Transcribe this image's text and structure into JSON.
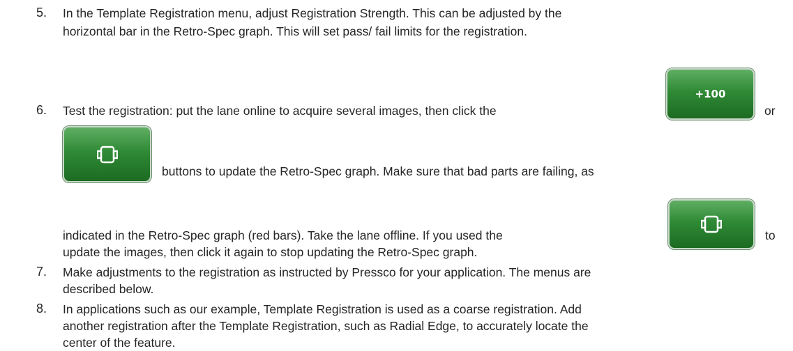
{
  "items": [
    {
      "number": "5.",
      "lines": [
        "In the Template Registration menu, adjust Registration Strength. This can be adjusted by the",
        "horizontal bar in the Retro-Spec graph. This will set pass/ fail limits for the registration."
      ]
    },
    {
      "number": "6.",
      "line1": "Test the registration: put the lane online to acquire several images, then click the",
      "line1_end": "or",
      "line2": "buttons to update the Retro-Spec graph. Make sure that bad parts are failing, as",
      "line3": "indicated in the Retro-Spec graph (red bars). Take the lane offline. If you used the",
      "line3_end": "to",
      "line4": "update the images, then click it again to stop updating the Retro-Spec graph."
    },
    {
      "number": "7.",
      "lines": [
        "Make adjustments to the registration as instructed by Pressco for your application. The menus are",
        "described below."
      ]
    },
    {
      "number": "8.",
      "lines": [
        "In applications such as our example, Template Registration is used as a coarse registration. Add",
        "another registration after the Template Registration, such as Radial Edge, to accurately locate the",
        "center of the feature."
      ]
    }
  ],
  "buttons": {
    "plus100_label": "+100",
    "camera_icon": "camera-icon",
    "color": "#2f8a35"
  }
}
